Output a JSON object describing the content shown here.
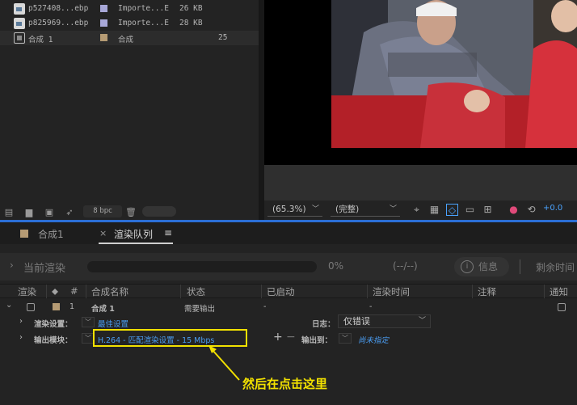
{
  "project": {
    "items": [
      {
        "name": "p527408...ebp",
        "type": "Importe...E",
        "size": "26 KB",
        "icon": "image-file-icon",
        "swatch": "#a8a8d8"
      },
      {
        "name": "p825969...ebp",
        "type": "Importe...E",
        "size": "28 KB",
        "icon": "image-file-icon",
        "swatch": "#a8a8d8"
      },
      {
        "name": "合成 1",
        "type": "合成",
        "size": "25",
        "icon": "composition-icon",
        "swatch": "#b59b74"
      }
    ],
    "bpc": "8 bpc"
  },
  "viewer": {
    "zoom": "(65.3%)",
    "resolution": "(完整)",
    "exposure": "+0.0"
  },
  "tabs": {
    "comp": "合成1",
    "render_queue": "渲染队列",
    "menu": "≡",
    "close": "×"
  },
  "current_render": {
    "label": "当前渲染",
    "percent": "0%",
    "eta": "(--/--)",
    "info": "信息",
    "remaining": "剩余时间"
  },
  "columns": [
    "渲染",
    "#",
    "合成名称",
    "状态",
    "已启动",
    "渲染时间",
    "注释",
    "通知"
  ],
  "queue_row": {
    "index": "1",
    "comp_name": "合成 1",
    "status": "需要输出",
    "started": "-",
    "render_time": "-"
  },
  "render_settings": {
    "label": "渲染设置：",
    "value": "最佳设置",
    "log_label": "日志：",
    "log_value": "仅错误"
  },
  "output_module": {
    "label": "输出模块：",
    "value": "H.264 - 匹配渲染设置 - 15 Mbps",
    "output_to_label": "输出到：",
    "output_to_value": "尚未指定"
  },
  "annotation": {
    "callout": "然后在点击这里",
    "color": "#f2e100"
  },
  "colors": {
    "accent_blue": "#2b6fd6",
    "link_blue": "#4a9cf0"
  }
}
